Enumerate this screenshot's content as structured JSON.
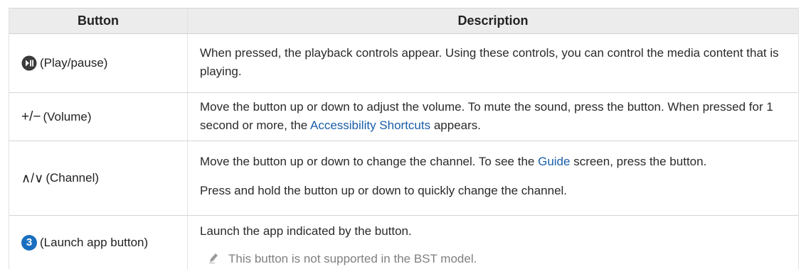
{
  "table": {
    "headers": {
      "button": "Button",
      "description": "Description"
    },
    "rows": [
      {
        "button_icon": "play-pause-icon",
        "button_label": "(Play/pause)",
        "description": "When pressed, the playback controls appear. Using these controls, you can control the media content that is playing."
      },
      {
        "button_icon": "plus-minus-icon",
        "button_glyphs": "+/−",
        "button_label": "(Volume)",
        "desc_before": "Move the button up or down to adjust the volume. To mute the sound, press the button. When pressed for 1 second or more, the ",
        "desc_link": "Accessibility Shortcuts",
        "desc_after": " appears."
      },
      {
        "button_icon": "up-down-chevron-icon",
        "button_glyphs": "∧/∨",
        "button_label": "(Channel)",
        "desc_before": "Move the button up or down to change the channel. To see the ",
        "desc_link": "Guide",
        "desc_after": " screen, press the button.",
        "desc_second": "Press and hold the button up or down to quickly change the channel."
      },
      {
        "button_icon": "number-3-icon",
        "button_icon_text": "3",
        "button_label": "(Launch app button)",
        "description": "Launch the app indicated by the button.",
        "note_icon": "pencil-icon",
        "note": "This button is not supported in the BST model."
      }
    ]
  },
  "colors": {
    "header_bg": "#ececec",
    "link": "#1a5ea8",
    "icon_blue": "#1a6fbf",
    "note_text": "#808080"
  }
}
